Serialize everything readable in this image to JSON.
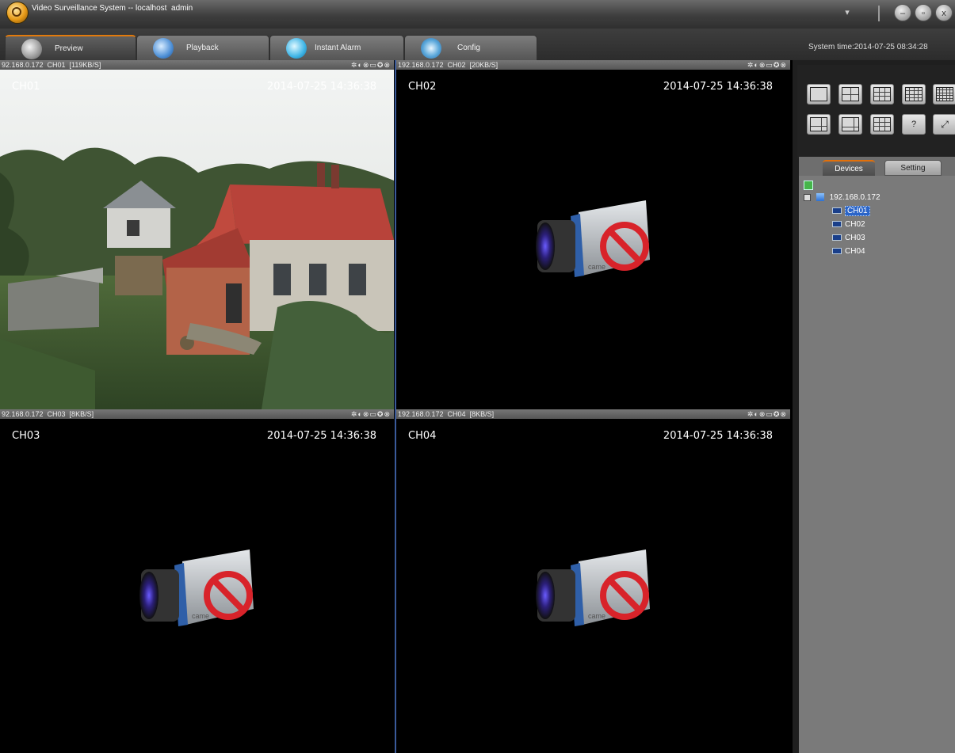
{
  "window": {
    "title": "Video Surveillance System -- localhost  admin"
  },
  "tabs": [
    {
      "label": "Preview",
      "icon": "surveillance-camera-icon",
      "active": true
    },
    {
      "label": "Playback",
      "icon": "film-reel-icon",
      "active": false
    },
    {
      "label": "Instant Alarm",
      "icon": "alarm-icon",
      "active": false
    },
    {
      "label": "Config",
      "icon": "gear-icon",
      "active": false
    }
  ],
  "system_time": "System time:2014-07-25 08:34:28",
  "panes": [
    {
      "info": "92.168.0.172  CH01  [119KB/S]",
      "channel": "CH01",
      "timestamp": "2014-07-25 14:36:38",
      "has_video": true
    },
    {
      "info": "192.168.0.172  CH02  [20KB/S]",
      "channel": "CH02",
      "timestamp": "2014-07-25 14:36:38",
      "has_video": false
    },
    {
      "info": "92.168.0.172  CH03  [8KB/S]",
      "channel": "CH03",
      "timestamp": "2014-07-25 14:36:38",
      "has_video": false
    },
    {
      "info": "192.168.0.172  CH04  [8KB/S]",
      "channel": "CH04",
      "timestamp": "2014-07-25 14:36:38",
      "has_video": false
    }
  ],
  "pane_icons": "✲◐⊗▭✪⊗",
  "camera_logo_text": "came",
  "right_tabs": {
    "devices": "Devices",
    "setting": "Setting"
  },
  "tree": {
    "device": "192.168.0.172",
    "channels": [
      "CH01",
      "CH02",
      "CH03",
      "CH04"
    ],
    "selected": "CH01"
  },
  "colors": {
    "accent": "#e27a0c",
    "selection": "#2a64c8"
  }
}
